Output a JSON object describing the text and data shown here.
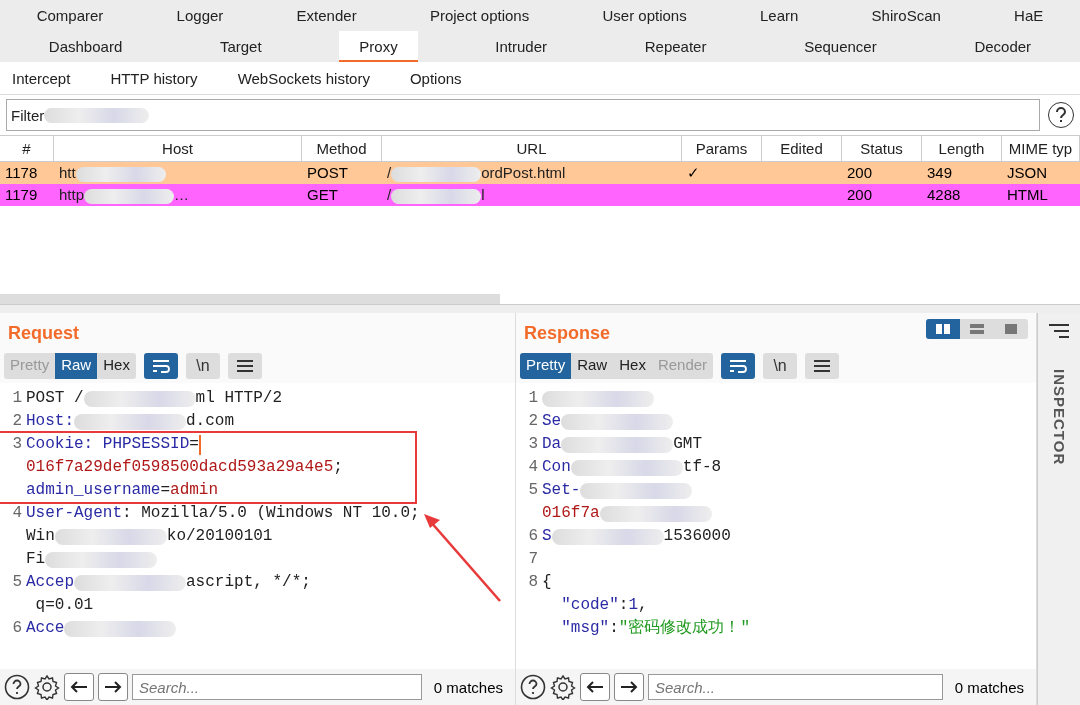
{
  "top_tabs": [
    [
      {
        "label": "Comparer",
        "selected": false
      },
      {
        "label": "Logger",
        "selected": false
      },
      {
        "label": "Extender",
        "selected": false
      },
      {
        "label": "Project options",
        "selected": false
      },
      {
        "label": "User options",
        "selected": false
      },
      {
        "label": "Learn",
        "selected": false
      },
      {
        "label": "ShiroScan",
        "selected": false
      },
      {
        "label": "HaE",
        "selected": false
      }
    ],
    [
      {
        "label": "Dashboard",
        "selected": false
      },
      {
        "label": "Target",
        "selected": false
      },
      {
        "label": "Proxy",
        "selected": true
      },
      {
        "label": "Intruder",
        "selected": false
      },
      {
        "label": "Repeater",
        "selected": false
      },
      {
        "label": "Sequencer",
        "selected": false
      },
      {
        "label": "Decoder",
        "selected": false
      }
    ]
  ],
  "sub_tabs": [
    "Intercept",
    "HTTP history",
    "WebSockets history",
    "Options"
  ],
  "filter": [
    {
      "kind": "plain",
      "text": "Filter"
    },
    {
      "kind": "redacted"
    }
  ],
  "table": {
    "columns": [
      "#",
      "Host",
      "Method",
      "URL",
      "Params",
      "Edited",
      "Status",
      "Length",
      "MIME typ"
    ],
    "rows": [
      {
        "color": "#ffc896",
        "cells": [
          "1178",
          [
            {
              "kind": "plain",
              "text": "htt"
            },
            {
              "kind": "redacted"
            }
          ],
          "POST",
          [
            {
              "kind": "plain",
              "text": "/"
            },
            {
              "kind": "redacted"
            },
            {
              "kind": "plain",
              "text": "ordPost.html"
            }
          ],
          "✓",
          "",
          "200",
          "349",
          "JSON"
        ]
      },
      {
        "color": "#ff64ff",
        "cells": [
          "1179",
          [
            {
              "kind": "plain",
              "text": "http"
            },
            {
              "kind": "redacted"
            },
            {
              "kind": "plain",
              "text": "…"
            }
          ],
          "GET",
          [
            {
              "kind": "plain",
              "text": "/"
            },
            {
              "kind": "redacted"
            },
            {
              "kind": "plain",
              "text": "l"
            }
          ],
          "",
          "",
          "200",
          "4288",
          "HTML"
        ]
      }
    ]
  },
  "request": {
    "title": "Request",
    "view_tabs": [
      {
        "label": "Pretty",
        "selected": false,
        "disabled": true
      },
      {
        "label": "Raw",
        "selected": true,
        "disabled": false
      },
      {
        "label": "Hex",
        "selected": false,
        "disabled": false
      }
    ],
    "tools": [
      {
        "kind": "wrap",
        "on": true
      },
      {
        "kind": "newline",
        "label": "\\n",
        "on": false
      },
      {
        "kind": "menu",
        "on": false
      }
    ],
    "lines": [
      {
        "number": "1",
        "boxed": false,
        "rows": [
          {
            "parts": [
              {
                "kind": "plain",
                "text": "POST /"
              },
              {
                "kind": "redacted"
              },
              {
                "kind": "plain",
                "text": "ml HTTP/2"
              }
            ]
          }
        ]
      },
      {
        "number": "2",
        "boxed": false,
        "rows": [
          {
            "parts": [
              {
                "kind": "key",
                "text": "Host:"
              },
              {
                "kind": "redacted"
              },
              {
                "kind": "plain",
                "text": "d.com"
              }
            ]
          }
        ]
      },
      {
        "number": "3",
        "boxed": true,
        "rows": [
          {
            "parts": [
              {
                "kind": "key",
                "text": "Cookie: PHPSESSID"
              },
              {
                "kind": "plain",
                "text": "="
              },
              {
                "kind": "cursor"
              }
            ]
          },
          {
            "parts": [
              {
                "kind": "value",
                "text": "016f7a29def0598500dacd593a29a4e5"
              },
              {
                "kind": "plain",
                "text": ";"
              }
            ]
          },
          {
            "parts": [
              {
                "kind": "key",
                "text": "admin_username"
              },
              {
                "kind": "plain",
                "text": "="
              },
              {
                "kind": "value",
                "text": "admin"
              }
            ]
          }
        ]
      },
      {
        "number": "4",
        "boxed": false,
        "rows": [
          {
            "parts": [
              {
                "kind": "key",
                "text": "User-Agent"
              },
              {
                "kind": "plain",
                "text": ": Mozilla/5.0 (Windows NT 10.0;"
              }
            ]
          },
          {
            "parts": [
              {
                "kind": "plain",
                "text": "Win"
              },
              {
                "kind": "redacted"
              },
              {
                "kind": "plain",
                "text": "ko/20100101"
              }
            ]
          },
          {
            "parts": [
              {
                "kind": "plain",
                "text": "Fi"
              },
              {
                "kind": "redacted"
              }
            ]
          }
        ]
      },
      {
        "number": "5",
        "boxed": false,
        "rows": [
          {
            "parts": [
              {
                "kind": "key",
                "text": "Accep"
              },
              {
                "kind": "redacted"
              },
              {
                "kind": "plain",
                "text": "ascript, */*;"
              }
            ]
          },
          {
            "parts": [
              {
                "kind": "plain",
                "text": " q=0.01"
              }
            ]
          }
        ]
      },
      {
        "number": "6",
        "boxed": false,
        "rows": [
          {
            "parts": [
              {
                "kind": "key",
                "text": "Acce"
              },
              {
                "kind": "redacted"
              }
            ]
          }
        ]
      }
    ],
    "search": {
      "placeholder": "Search..."
    },
    "matches": "0 matches"
  },
  "response": {
    "title": "Response",
    "layout_modes": [
      {
        "kind": "split",
        "selected": true
      },
      {
        "kind": "stack",
        "selected": false
      },
      {
        "kind": "single",
        "selected": false
      }
    ],
    "view_tabs": [
      {
        "label": "Pretty",
        "selected": true,
        "disabled": false
      },
      {
        "label": "Raw",
        "selected": false,
        "disabled": false
      },
      {
        "label": "Hex",
        "selected": false,
        "disabled": false
      },
      {
        "label": "Render",
        "selected": false,
        "disabled": true
      }
    ],
    "tools": [
      {
        "kind": "wrap",
        "on": true
      },
      {
        "kind": "newline",
        "label": "\\n",
        "on": false
      },
      {
        "kind": "menu",
        "on": false
      }
    ],
    "lines": [
      {
        "number": "1",
        "boxed": false,
        "rows": [
          {
            "parts": [
              {
                "kind": "redacted"
              }
            ]
          }
        ]
      },
      {
        "number": "2",
        "boxed": false,
        "rows": [
          {
            "parts": [
              {
                "kind": "key",
                "text": "Se"
              },
              {
                "kind": "redacted"
              }
            ]
          }
        ]
      },
      {
        "number": "3",
        "boxed": false,
        "rows": [
          {
            "parts": [
              {
                "kind": "key",
                "text": "Da"
              },
              {
                "kind": "redacted"
              },
              {
                "kind": "plain",
                "text": "GMT"
              }
            ]
          }
        ]
      },
      {
        "number": "4",
        "boxed": false,
        "rows": [
          {
            "parts": [
              {
                "kind": "key",
                "text": "Con"
              },
              {
                "kind": "redacted"
              },
              {
                "kind": "plain",
                "text": "tf-8"
              }
            ]
          }
        ]
      },
      {
        "number": "5",
        "boxed": false,
        "rows": [
          {
            "parts": [
              {
                "kind": "key",
                "text": "Set-"
              },
              {
                "kind": "redacted"
              }
            ]
          },
          {
            "parts": [
              {
                "kind": "value",
                "text": "016f7a"
              },
              {
                "kind": "redacted"
              }
            ]
          }
        ]
      },
      {
        "number": "6",
        "boxed": false,
        "rows": [
          {
            "parts": [
              {
                "kind": "key",
                "text": "S"
              },
              {
                "kind": "redacted"
              },
              {
                "kind": "plain",
                "text": "1536000"
              }
            ]
          }
        ]
      },
      {
        "number": "7",
        "boxed": false,
        "rows": [
          {
            "parts": []
          }
        ]
      },
      {
        "number": "8",
        "boxed": false,
        "rows": [
          {
            "parts": [
              {
                "kind": "plain",
                "text": "{"
              }
            ]
          },
          {
            "parts": [
              {
                "kind": "key",
                "text": "  \"code\""
              },
              {
                "kind": "plain",
                "text": ":"
              },
              {
                "kind": "number",
                "text": "1"
              },
              {
                "kind": "plain",
                "text": ","
              }
            ]
          },
          {
            "parts": [
              {
                "kind": "key",
                "text": "  \"msg\""
              },
              {
                "kind": "plain",
                "text": ":"
              },
              {
                "kind": "string",
                "text": "\"密码修改成功！\""
              }
            ]
          }
        ]
      }
    ],
    "search": {
      "placeholder": "Search..."
    },
    "matches": "0 matches"
  },
  "inspector": {
    "label": "INSPECTOR"
  }
}
